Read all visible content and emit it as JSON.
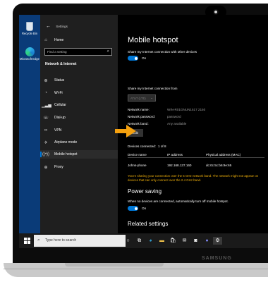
{
  "desktop": {
    "icons": [
      {
        "label": "Recycle Bin",
        "icon": "recycle-bin-icon"
      },
      {
        "label": "Microsoft Edge",
        "icon": "edge-icon"
      }
    ]
  },
  "nav": {
    "title": "Settings",
    "home": "Home",
    "search_placeholder": "Find a setting",
    "section": "Network & Internet",
    "items": [
      {
        "label": "Status",
        "icon": "status-icon"
      },
      {
        "label": "Wi-Fi",
        "icon": "wifi-icon"
      },
      {
        "label": "Cellular",
        "icon": "cellular-icon"
      },
      {
        "label": "Dial-up",
        "icon": "dialup-icon"
      },
      {
        "label": "VPN",
        "icon": "vpn-icon"
      },
      {
        "label": "Airplane mode",
        "icon": "airplane-icon"
      },
      {
        "label": "Mobile hotspot",
        "icon": "hotspot-icon"
      },
      {
        "label": "Proxy",
        "icon": "proxy-icon"
      }
    ],
    "active_item": "Mobile hotspot"
  },
  "content": {
    "title": "Mobile hotspot",
    "share_label": "Share my Internet connection with other devices",
    "share_state": "On",
    "share_from_label": "Share my Internet connection from",
    "share_from_value": "AT&T (LTE)",
    "network_name_label": "Network name:",
    "network_name_value": "WIN-R01GNUN1517 2150",
    "network_password_label": "Network password:",
    "network_password_value": "password",
    "network_band_label": "Network band:",
    "network_band_value": "Any available",
    "edit_button": "Edit",
    "devices_connected_label": "Devices connected:",
    "devices_connected_value": "1 of 8",
    "table_headers": [
      "Device name",
      "IP address",
      "Physical address (MAC)"
    ],
    "table_rows": [
      [
        "Johns-phone",
        "192.168.137.160",
        "dc:0c:5c:b6:9e:65"
      ]
    ],
    "warning": "You're sharing your connection over the 5 GHz network band. The network might not appear on devices that can only connect over the 2.4 GHz band.",
    "power_saving_title": "Power saving",
    "power_saving_label": "When no devices are connected, automatically turn off mobile hotspot.",
    "power_saving_state": "On",
    "related_title": "Related settings"
  },
  "taskbar": {
    "search_placeholder": "Type here to search",
    "icons": [
      "cortana-icon",
      "task-view-icon",
      "edge-icon",
      "file-explorer-icon",
      "store-icon",
      "mail-icon",
      "camera-icon",
      "teams-icon",
      "settings-icon"
    ]
  },
  "device": {
    "brand": "SAMSUNG"
  },
  "colors": {
    "accent": "#0078d7",
    "warning": "#f2b20b",
    "arrow": "#f5a10f"
  }
}
